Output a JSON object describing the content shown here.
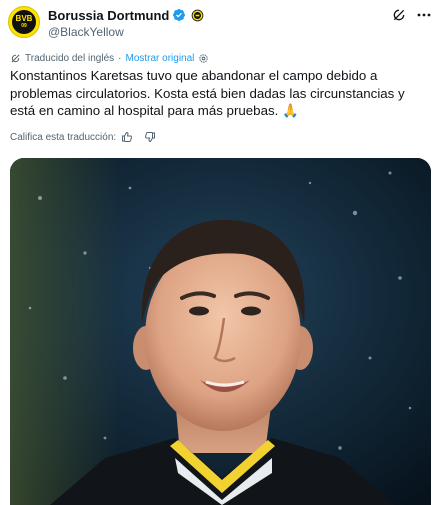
{
  "account": {
    "name": "Borussia Dortmund",
    "handle": "@BlackYellow",
    "avatar_text": "BVB",
    "avatar_year": "09",
    "verified_icon": "verified-badge-icon",
    "club_badge_icon": "bvb-badge-icon"
  },
  "translation": {
    "notice": "Traducido del inglés",
    "show_original": "Mostrar original"
  },
  "post": {
    "text": "Konstantinos Karetsas tuvo que abandonar el campo debido a problemas circulatorios. Kosta está bien dadas las circunstancias y está en camino al hospital para más pruebas. 🙏"
  },
  "rating": {
    "label": "Califica esta traducción:"
  },
  "media": {
    "description_icon": "player-photo"
  },
  "colors": {
    "link": "#1d9bf0",
    "secondary": "#536471",
    "text": "#0f1419",
    "brand_yellow": "#fde100"
  }
}
